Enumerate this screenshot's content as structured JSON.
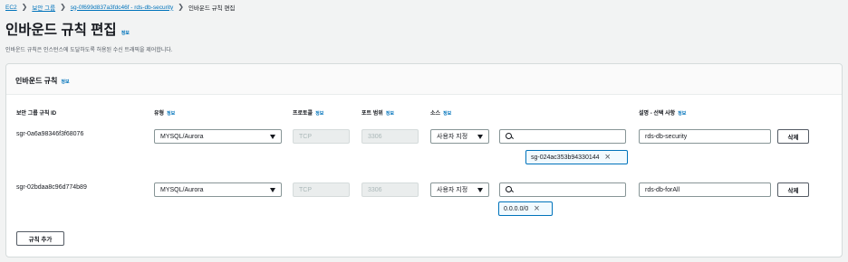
{
  "breadcrumb": {
    "items": [
      "EC2",
      "보안 그룹",
      "sg-0f699d837a3fdc46f - rds-db-security"
    ],
    "current": "인바운드 규칙 편집",
    "separator": "❯"
  },
  "page": {
    "title": "인바운드 규칙 편집",
    "info": "정보",
    "description": "인바운드 규칙은 인스턴스에 도달하도록 허용된 수신 트래픽을 제어합니다."
  },
  "panel": {
    "title": "인바운드 규칙",
    "info": "정보"
  },
  "columns": {
    "rule_id": "보안 그룹 규칙 ID",
    "type": "유형",
    "protocol": "프로토콜",
    "port_range": "포트 범위",
    "source": "소스",
    "description": "설명 - 선택 사항",
    "info": "정보"
  },
  "rules": [
    {
      "id": "sgr-0a6a98346f3f68076",
      "type": "MYSQL/Aurora",
      "protocol": "TCP",
      "port": "3306",
      "source_type": "사용자 지정",
      "search_value": "",
      "token": "sg-024ac353b94330144",
      "description": "rds-db-security",
      "delete_label": "삭제"
    },
    {
      "id": "sgr-02bdaa8c96d774b89",
      "type": "MYSQL/Aurora",
      "protocol": "TCP",
      "port": "3306",
      "source_type": "사용자 지정",
      "search_value": "",
      "token": "0.0.0.0/0",
      "description": "rds-db-forAll",
      "delete_label": "삭제"
    }
  ],
  "add_rule_label": "규칙 추가",
  "colors": {
    "link": "#0073bb",
    "background": "#f2f3f3",
    "token_border": "#0073bb",
    "token_bg": "#f1faff"
  }
}
